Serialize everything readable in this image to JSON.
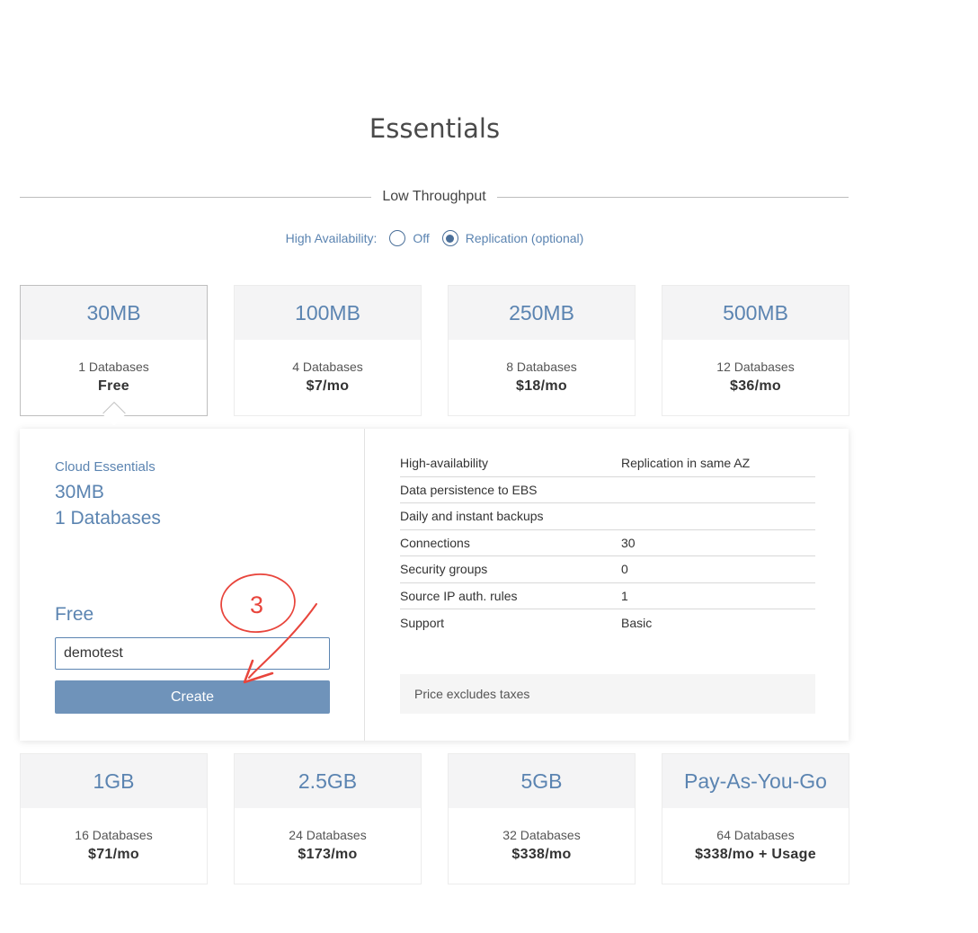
{
  "page": {
    "title": "Essentials"
  },
  "section": {
    "label": "Low Throughput"
  },
  "high_availability": {
    "label": "High Availability:",
    "options": [
      {
        "label": "Off",
        "checked": false
      },
      {
        "label": "Replication (optional)",
        "checked": true
      }
    ]
  },
  "plans_top": [
    {
      "size": "30MB",
      "databases": "1 Databases",
      "price": "Free",
      "selected": true
    },
    {
      "size": "100MB",
      "databases": "4 Databases",
      "price": "$7/mo",
      "selected": false
    },
    {
      "size": "250MB",
      "databases": "8 Databases",
      "price": "$18/mo",
      "selected": false
    },
    {
      "size": "500MB",
      "databases": "12 Databases",
      "price": "$36/mo",
      "selected": false
    }
  ],
  "plans_bottom": [
    {
      "size": "1GB",
      "databases": "16 Databases",
      "price": "$71/mo"
    },
    {
      "size": "2.5GB",
      "databases": "24 Databases",
      "price": "$173/mo"
    },
    {
      "size": "5GB",
      "databases": "32 Databases",
      "price": "$338/mo"
    },
    {
      "size": "Pay-As-You-Go",
      "databases": "64 Databases",
      "price": "$338/mo + Usage"
    }
  ],
  "detail": {
    "tier": "Cloud Essentials",
    "size": "30MB",
    "databases": "1 Databases",
    "price": "Free",
    "name_input_value": "demotest",
    "create_label": "Create",
    "specs": [
      {
        "key": "High-availability",
        "value": "Replication in same AZ"
      },
      {
        "key": "Data persistence to EBS",
        "value": ""
      },
      {
        "key": "Daily and instant backups",
        "value": ""
      },
      {
        "key": "Connections",
        "value": "30"
      },
      {
        "key": "Security groups",
        "value": "0"
      },
      {
        "key": "Source IP auth. rules",
        "value": "1"
      },
      {
        "key": "Support",
        "value": "Basic"
      }
    ],
    "tax_note": "Price excludes taxes"
  },
  "annotation": {
    "step_number": "3",
    "color": "#e8453c"
  },
  "colors": {
    "accent": "#5b84b1",
    "button": "#6f93ba",
    "card_head": "#f4f4f5"
  }
}
